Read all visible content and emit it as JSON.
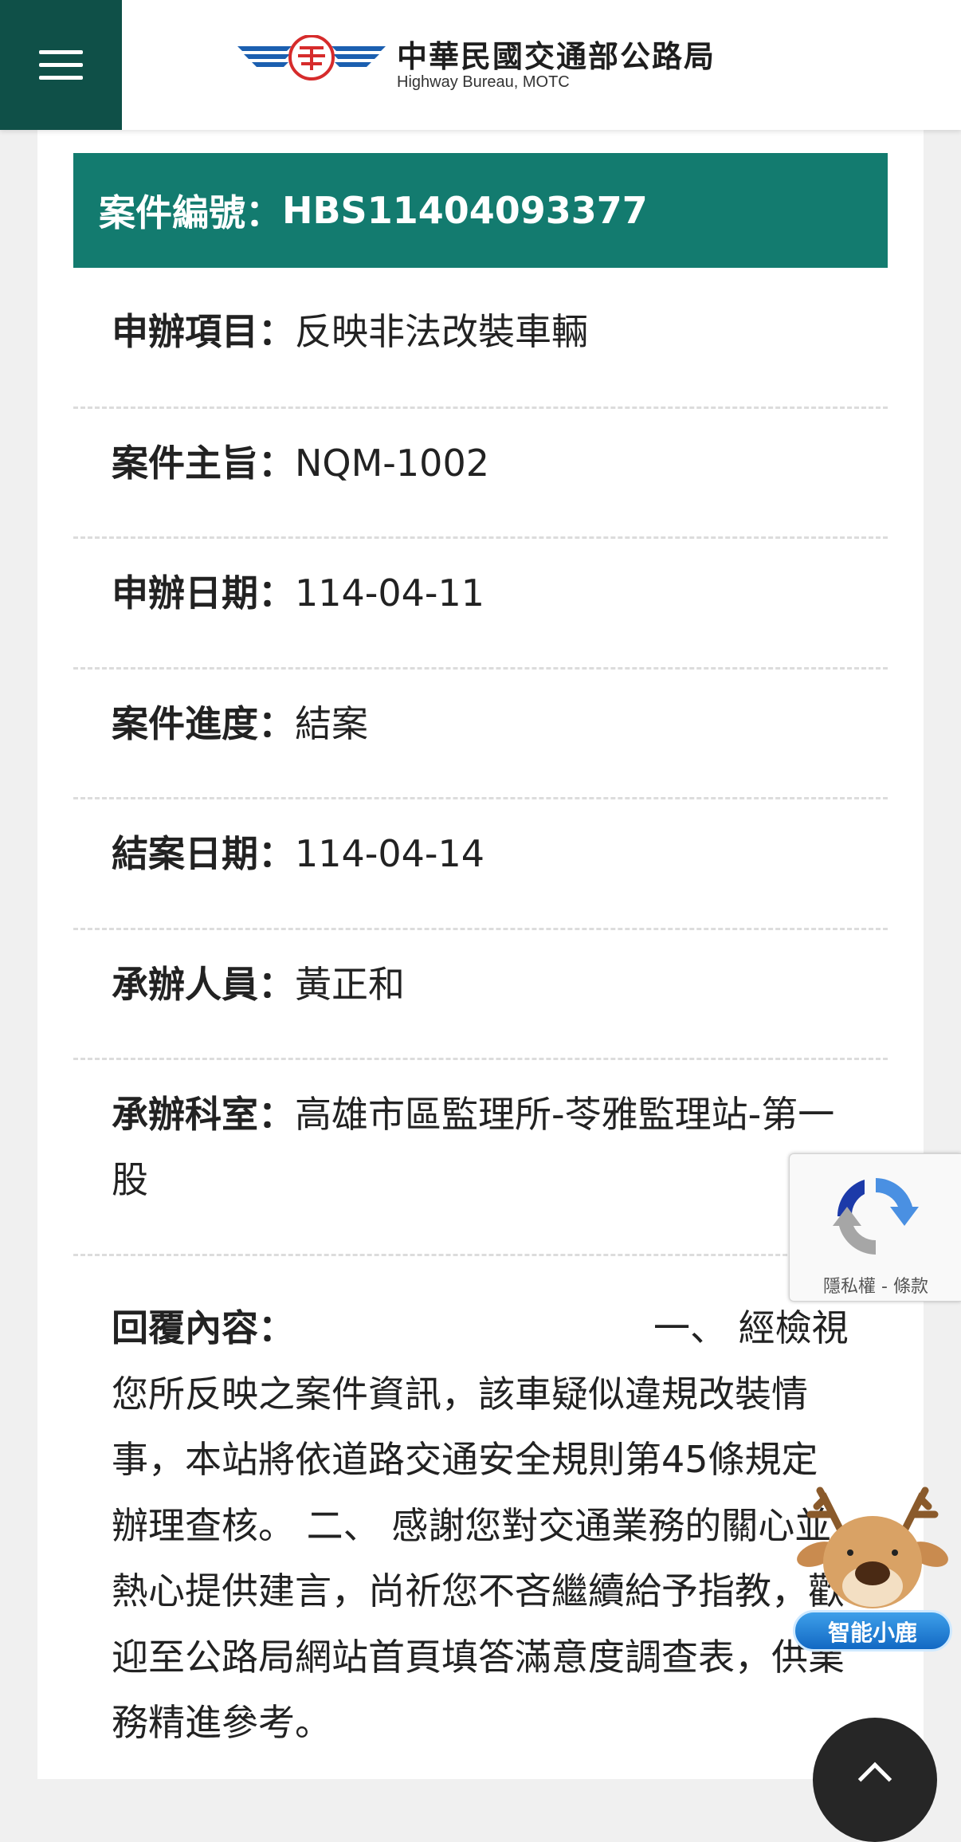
{
  "header": {
    "logo_title": "中華民國交通部公路局",
    "logo_subtitle": "Highway Bureau, MOTC"
  },
  "case": {
    "number_label": "案件編號：",
    "number_value": "HBS11404093377",
    "fields": [
      {
        "label": "申辦項目：",
        "value": "反映非法改裝車輛"
      },
      {
        "label": "案件主旨：",
        "value": "NQM-1002"
      },
      {
        "label": "申辦日期：",
        "value": "114-04-11"
      },
      {
        "label": "案件進度：",
        "value": "結案"
      },
      {
        "label": "結案日期：",
        "value": "114-04-14"
      },
      {
        "label": "承辦人員：",
        "value": "黃正和"
      },
      {
        "label": "承辦科室：",
        "value": "高雄市區監理所-苓雅監理站-第一股"
      }
    ],
    "reply_label": "回覆內容：",
    "reply_value": "一、 經檢視您所反映之案件資訊，該車疑似違規改裝情事，本站將依道路交通安全規則第45條規定辦理查核。 二、 感謝您對交通業務的關心並熱心提供建言，尚祈您不吝繼續給予指教，歡迎至公路局網站首頁填答滿意度調查表，供業務精進參考。"
  },
  "recaptcha": {
    "links": "隱私權 - 條款"
  },
  "assistant": {
    "label": "智能小鹿"
  },
  "colors": {
    "header_menu_bg": "#0f5048",
    "case_header_bg": "#137b6f"
  }
}
